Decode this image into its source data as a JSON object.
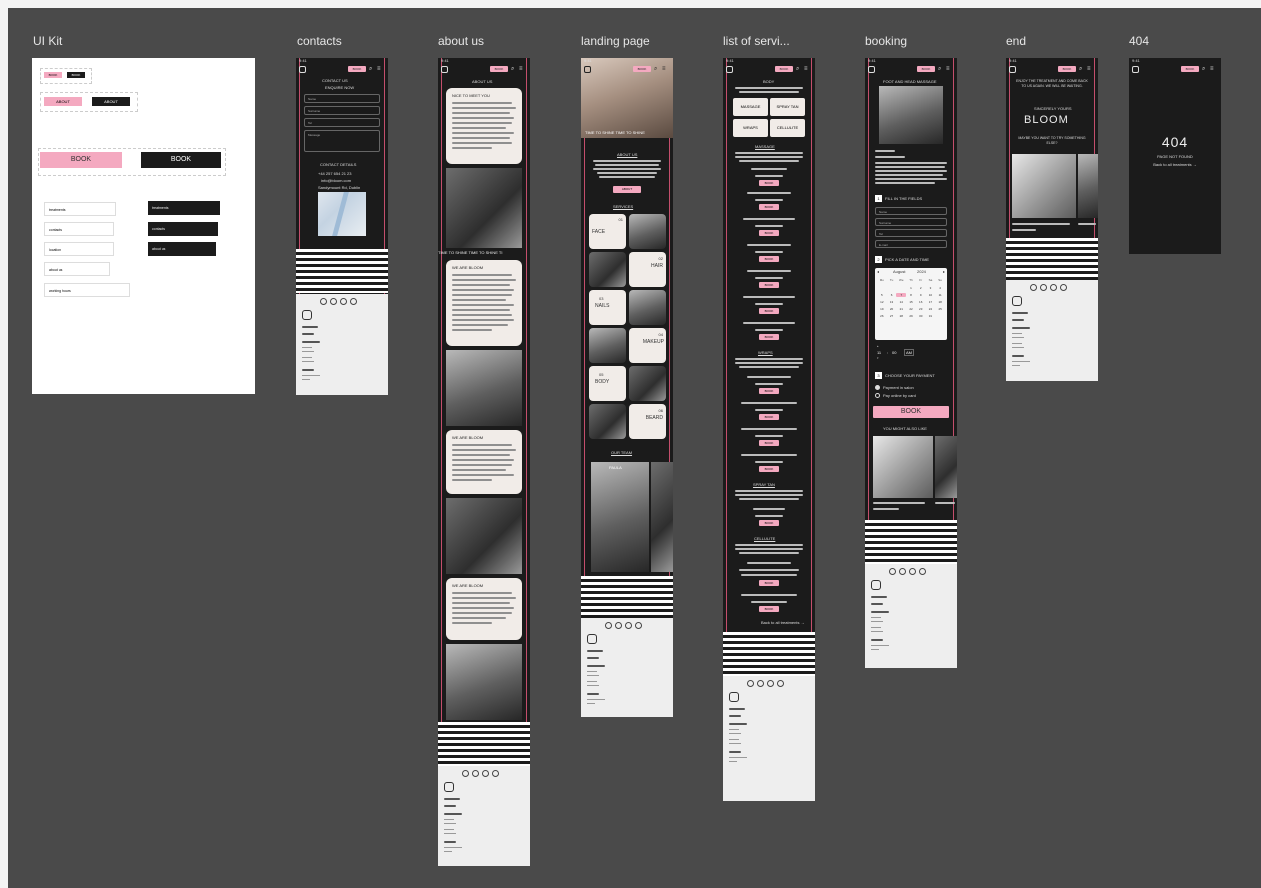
{
  "canvas": {
    "background": "#4a4a4a"
  },
  "frames": [
    {
      "label": "UI Kit"
    },
    {
      "label": "contacts"
    },
    {
      "label": "about us"
    },
    {
      "label": "landing page"
    },
    {
      "label": "list of servi..."
    },
    {
      "label": "booking"
    },
    {
      "label": "end"
    },
    {
      "label": "404"
    }
  ],
  "ui_kit": {
    "small_buttons": [
      "BOOK",
      "BOOK"
    ],
    "medium_buttons": [
      "ABOUT",
      "ABOUT"
    ],
    "large_buttons": [
      "BOOK",
      "BOOK"
    ],
    "menu_items_light": [
      "treatments",
      "contacts",
      "location",
      "about us",
      "working hours"
    ],
    "menu_items_dark": [
      "treatments",
      "contacts",
      "about us"
    ]
  },
  "contacts_frame": {
    "title": "CONTACT US",
    "subtitle": "ENQUIRE NOW",
    "fields": [
      "Name",
      "Surname",
      "Tel",
      "Message"
    ],
    "contact_heading": "CONTACT DETAILS",
    "contact_lines": [
      "+44 257 654 21 23",
      "info@bloom.com",
      "Sandymount Rd, Dublin"
    ]
  },
  "about_frame": {
    "header": "ABOUT US",
    "card_1_title": "NICE TO MEET YOU",
    "banner": "TIME TO SHINE TIME TO SHINE TI",
    "card_2_title": "WE ARE BLOOM",
    "card_3_title": "WE ARE BLOOM",
    "card_4_title": "WE ARE BLOOM"
  },
  "landing_frame": {
    "banner": "TIME TO SHINE TIME TO SHINE",
    "section_heading": "ABOUT US",
    "button": "ABOUT",
    "services_heading": "SERVICES",
    "tiles": [
      {
        "num": "01",
        "label": "FACE"
      },
      {
        "num": "02",
        "label": "HAIR"
      },
      {
        "num": "03",
        "label": "NAILS"
      },
      {
        "num": "04",
        "label": "MAKEUP"
      },
      {
        "num": "05",
        "label": "BODY"
      },
      {
        "num": "06",
        "label": "BEARD"
      }
    ],
    "team_heading": "OUR TEAM",
    "team_label": "PAULA"
  },
  "services_frame": {
    "header": "BODY",
    "categories": [
      "MASSAGE",
      "SPRAY TAN",
      "WRAPS",
      "CELLULITE"
    ],
    "sections": [
      "MASSAGE",
      "WRAPS",
      "SPRAY TAN",
      "CELLULITE"
    ],
    "button": "BOOK",
    "back_link": "Back to all treatments →"
  },
  "booking_frame": {
    "title": "FOOT AND HEAD MASSAGE",
    "step_1": "FILL IN THE FIELDS",
    "fields": [
      "Name",
      "Surname",
      "Tel",
      "E-mail"
    ],
    "step_2": "PICK A DATE AND TIME",
    "calendar": {
      "month": "August",
      "year": "2024",
      "weekdays": [
        "Mo",
        "Tu",
        "We",
        "Th",
        "Fr",
        "Sa",
        "Su"
      ],
      "days": [
        "",
        "",
        "",
        "1",
        "2",
        "3",
        "4",
        "5",
        "6",
        "7",
        "8",
        "9",
        "10",
        "11",
        "12",
        "13",
        "14",
        "15",
        "16",
        "17",
        "18",
        "19",
        "20",
        "21",
        "22",
        "23",
        "24",
        "25",
        "26",
        "27",
        "28",
        "29",
        "30",
        "31",
        ""
      ],
      "selected_day": "7"
    },
    "time": {
      "hour": "11",
      "minute": "00",
      "period": "AM"
    },
    "step_3": "CHOOSE YOUR PAYMENT",
    "payment_options": [
      "Payment in salon",
      "Pay online by card"
    ],
    "book_button": "BOOK",
    "also_like": "YOU MIGHT ALSO LIKE"
  },
  "end_frame": {
    "heading": "ENJOY THE TREATMENT AND COME BACK TO US AGAIN. WE WILL BE WAITING.",
    "signoff": "SINCERELY YOURS",
    "brand": "BLOOM",
    "also_like": "MAYBE YOU WANT TO TRY SOMETHING ELSE?"
  },
  "notfound_frame": {
    "code": "404",
    "message": "PAGE NOT FOUND",
    "link": "Back to all treatments →"
  },
  "common": {
    "status_time": "9:41",
    "book_pill": "BOOK",
    "footer_lines": [
      "treatments",
      "about us",
      "working hours",
      "location"
    ]
  },
  "colors": {
    "pink": "#f4a9c0",
    "dark": "#1b1b1b",
    "guide": "#e2577a"
  }
}
